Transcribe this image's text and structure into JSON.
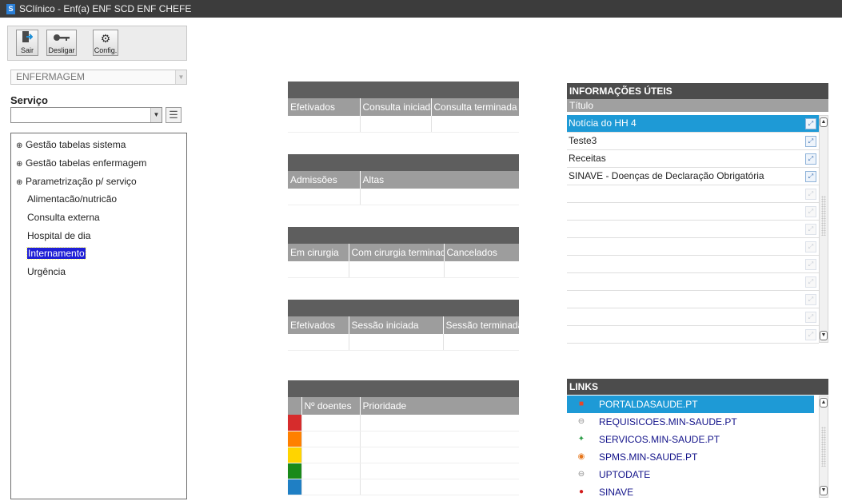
{
  "window": {
    "app_icon": "S",
    "title": "SClínico - Enf(a) ENF SCD ENF CHEFE"
  },
  "toolbar": {
    "exit_label": "Sair",
    "logoff_label": "Desligar",
    "config_label": "Config."
  },
  "module": {
    "selected": "ENFERMAGEM"
  },
  "servico": {
    "label": "Serviço",
    "value": ""
  },
  "tree": {
    "items": [
      {
        "label": "Gestão tabelas sistema",
        "expander": "⊕"
      },
      {
        "label": "Gestão tabelas enfermagem",
        "expander": "⊕"
      },
      {
        "label": "Parametrização p/ serviço",
        "expander": "⊕"
      },
      {
        "label": "Alimentacão/nutricão"
      },
      {
        "label": "Consulta externa"
      },
      {
        "label": "Hospital de dia"
      },
      {
        "label": "Internamento",
        "selected": true
      },
      {
        "label": "Urgência"
      }
    ]
  },
  "panels": {
    "consultas": {
      "columns": [
        "Efetivados",
        "Consulta iniciada",
        "Consulta terminada"
      ]
    },
    "internamento": {
      "columns": [
        "Admissões",
        "Altas"
      ]
    },
    "cirurgia": {
      "columns": [
        "Em cirurgia",
        "Com cirurgia terminada",
        "Cancelados"
      ]
    },
    "sessoes": {
      "columns": [
        "Efetivados",
        "Sessão iniciada",
        "Sessão terminada"
      ]
    },
    "triagem": {
      "columns": [
        "",
        "Nº doentes",
        "Prioridade"
      ],
      "priority_colors": [
        "#d62c2c",
        "#ff8000",
        "#ffd400",
        "#1a8a1a",
        "#1f7fc4"
      ]
    }
  },
  "info": {
    "title": "INFORMAÇÕES ÚTEIS",
    "column": "Título",
    "rows": [
      "Notícia  do HH 4",
      "Teste3",
      "Receitas",
      "SINAVE - Doenças de Declaração Obrigatória",
      "",
      "",
      "",
      "",
      "",
      "",
      "",
      "",
      ""
    ]
  },
  "links": {
    "title": "LINKS",
    "items": [
      {
        "label": "PORTALDASAUDE.PT",
        "icon": "portal-icon",
        "color": "#e8462a"
      },
      {
        "label": "REQUISICOES.MIN-SAUDE.PT",
        "icon": "link-icon",
        "color": "#8a8a8a"
      },
      {
        "label": "SERVICOS.MIN-SAUDE.PT",
        "icon": "servicos-icon",
        "color": "#2e9e4a"
      },
      {
        "label": "SPMS.MIN-SAUDE.PT",
        "icon": "spms-icon",
        "color": "#e6751a"
      },
      {
        "label": "UPTODATE",
        "icon": "link-icon",
        "color": "#8a8a8a"
      },
      {
        "label": "SINAVE",
        "icon": "sinave-icon",
        "color": "#d21c1c"
      }
    ]
  }
}
